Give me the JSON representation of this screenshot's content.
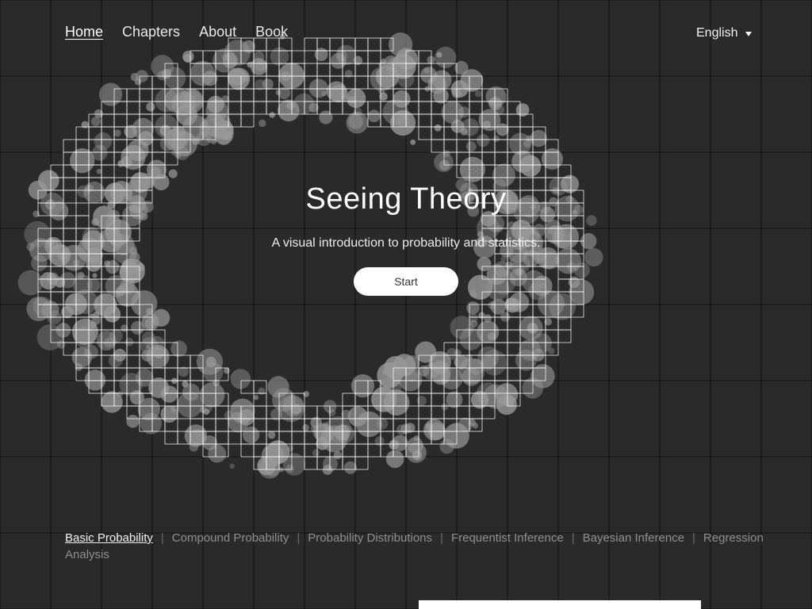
{
  "nav": {
    "items": [
      {
        "label": "Home",
        "active": true
      },
      {
        "label": "Chapters",
        "active": false
      },
      {
        "label": "About",
        "active": false
      },
      {
        "label": "Book",
        "active": false
      }
    ]
  },
  "language": {
    "selected": "English",
    "icon": "caret-down-icon"
  },
  "hero": {
    "title": "Seeing Theory",
    "subtitle": "A visual introduction to probability and statistics.",
    "start_label": "Start"
  },
  "chapters": [
    {
      "label": "Basic Probability",
      "active": true
    },
    {
      "label": "Compound Probability",
      "active": false
    },
    {
      "label": "Probability Distributions",
      "active": false
    },
    {
      "label": "Frequentist Inference",
      "active": false
    },
    {
      "label": "Bayesian Inference",
      "active": false
    },
    {
      "label": "Regression Analysis",
      "active": false
    }
  ],
  "colors": {
    "background": "#2a2a2a",
    "grid_line": "#111111",
    "circle": "#9a9a9a",
    "text": "#ffffff"
  }
}
